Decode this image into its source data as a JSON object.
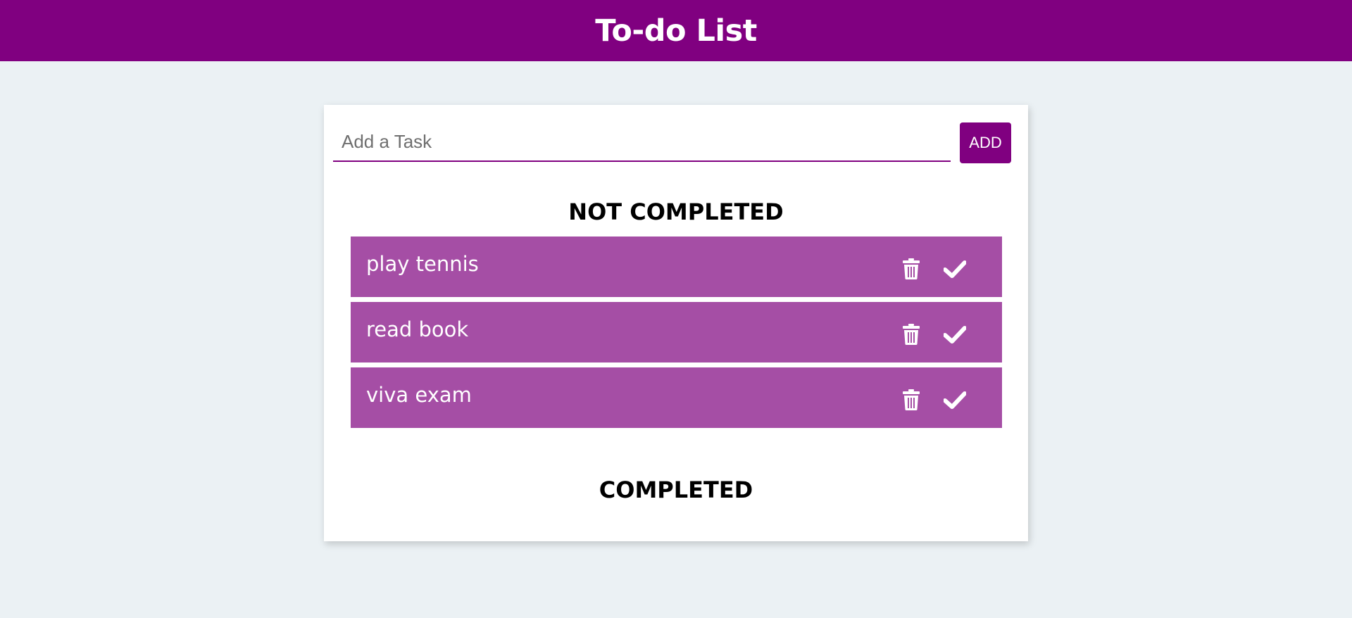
{
  "header": {
    "title": "To-do List"
  },
  "input": {
    "placeholder": "Add a Task",
    "value": ""
  },
  "add_button": {
    "label": "ADD"
  },
  "sections": {
    "not_completed": "NOT COMPLETED",
    "completed": "COMPLETED"
  },
  "tasks_not_completed": [
    {
      "text": "play tennis",
      "delete_icon": "trash-icon",
      "complete_icon": "check-icon"
    },
    {
      "text": "read book",
      "delete_icon": "trash-icon",
      "complete_icon": "check-icon"
    },
    {
      "text": "viva exam",
      "delete_icon": "trash-icon",
      "complete_icon": "check-icon"
    }
  ],
  "tasks_completed": [],
  "colors": {
    "brand": "#800080",
    "task_background": "#a54ea5",
    "page_background": "#ebf1f4"
  }
}
